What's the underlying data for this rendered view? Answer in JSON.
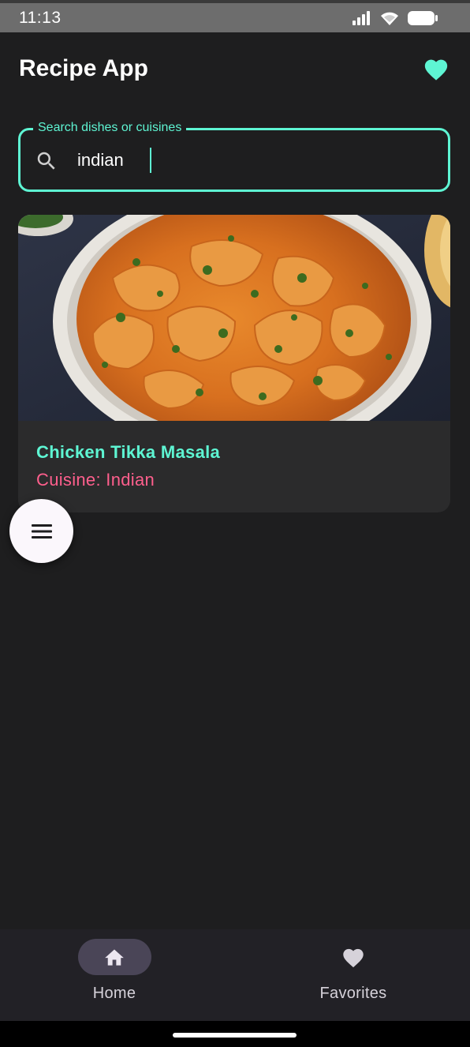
{
  "status_bar": {
    "time": "11:13"
  },
  "app_bar": {
    "title": "Recipe App"
  },
  "search": {
    "label": "Search dishes or cuisines",
    "value": "indian"
  },
  "results": [
    {
      "title": "Chicken Tikka Masala",
      "cuisine": "Cuisine: Indian"
    }
  ],
  "bottom_nav": {
    "home_label": "Home",
    "favorites_label": "Favorites",
    "active": "Home"
  },
  "colors": {
    "accent": "#5ef5d3",
    "cuisine_text": "#ff5f8d",
    "background": "#1e1e1f",
    "card": "#2b2b2c"
  }
}
